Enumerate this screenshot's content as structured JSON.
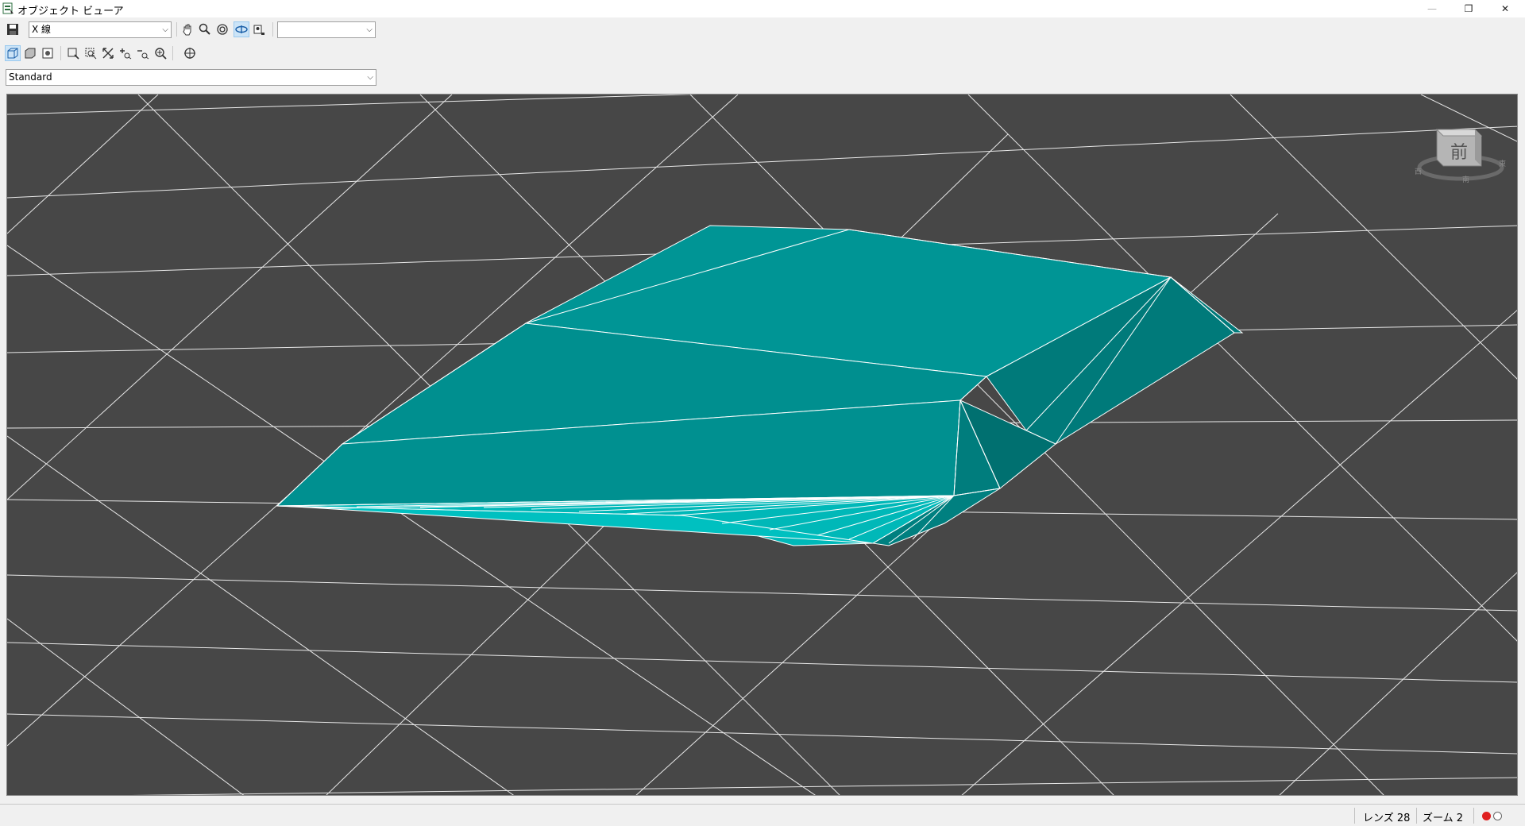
{
  "window": {
    "title": "オブジェクト ビューア",
    "controls": {
      "minimize": "—",
      "maximize": "❐",
      "close": "✕"
    }
  },
  "toolbar": {
    "visual_style": {
      "value": "X 線",
      "arrow": "⌵"
    },
    "named_view": {
      "value": "",
      "arrow": "⌵"
    },
    "ucs": {
      "value": "Standard",
      "arrow": "⌵"
    },
    "row1_buttons": [
      "save-icon",
      "pan-icon",
      "zoom-icon",
      "orbit-icon",
      "free-orbit-icon",
      "continuous-orbit-icon",
      "camera-icon"
    ],
    "row2_buttons": [
      "wireframe-view-icon",
      "shaded-view-icon",
      "visual-style-manager-icon",
      "zoom-window-icon",
      "zoom-extents-icon",
      "zoom-all-icon",
      "zoom-in-icon",
      "zoom-out-icon",
      "zoom-realtime-icon",
      "ucs-icon"
    ]
  },
  "viewcube": {
    "face_label": "前",
    "compass_n": "北",
    "compass_s": "南",
    "compass_e": "東",
    "compass_w": "西"
  },
  "viewport": {
    "background": "#474747",
    "grid_line_color": "#ffffff",
    "mesh_colors": [
      "#00bcbc",
      "#009595",
      "#008a8a",
      "#007878",
      "#006e6e"
    ]
  },
  "status": {
    "lens": "レンズ 28",
    "zoom": "ズーム 2"
  },
  "colors": {
    "record_dot": "#e02020"
  }
}
